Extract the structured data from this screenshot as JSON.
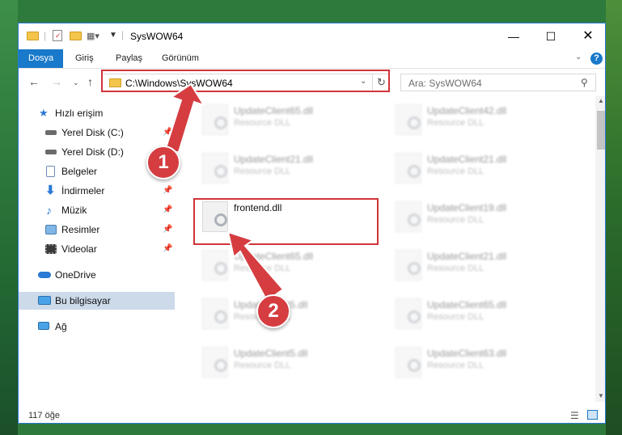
{
  "window": {
    "title": "SysWOW64"
  },
  "ribbon": {
    "tabs": [
      "Dosya",
      "Giriş",
      "Paylaş",
      "Görünüm"
    ]
  },
  "address": {
    "path": "C:\\Windows\\SysWOW64"
  },
  "search": {
    "placeholder": "Ara: SysWOW64"
  },
  "sidebar": {
    "items": [
      {
        "label": "Hızlı erişim",
        "icon": "star-icon",
        "pinned": false
      },
      {
        "label": "Yerel Disk (C:)",
        "icon": "drive-icon",
        "pinned": true
      },
      {
        "label": "Yerel Disk (D:)",
        "icon": "drive-icon",
        "pinned": true
      },
      {
        "label": "Belgeler",
        "icon": "documents-icon",
        "pinned": true
      },
      {
        "label": "İndirmeler",
        "icon": "download-icon",
        "pinned": true
      },
      {
        "label": "Müzik",
        "icon": "music-icon",
        "pinned": true
      },
      {
        "label": "Resimler",
        "icon": "pictures-icon",
        "pinned": true
      },
      {
        "label": "Videolar",
        "icon": "videos-icon",
        "pinned": true
      },
      {
        "label": "OneDrive",
        "icon": "cloud-icon",
        "pinned": false
      },
      {
        "label": "Bu bilgisayar",
        "icon": "computer-icon",
        "pinned": false
      },
      {
        "label": "Ağ",
        "icon": "network-icon",
        "pinned": false
      }
    ]
  },
  "files": [
    {
      "name": "UpdateClient65.dll",
      "desc": "Resource DLL"
    },
    {
      "name": "UpdateClient42.dll",
      "desc": "Resource DLL"
    },
    {
      "name": "UpdateClient21.dll",
      "desc": "Resource DLL"
    },
    {
      "name": "UpdateClient21.dll",
      "desc": "Resource DLL"
    },
    {
      "name": "frontend.dll",
      "desc": ""
    },
    {
      "name": "UpdateClient19.dll",
      "desc": "Resource DLL"
    },
    {
      "name": "UpdateClient65.dll",
      "desc": "Resource DLL"
    },
    {
      "name": "UpdateClient21.dll",
      "desc": "Resource DLL"
    },
    {
      "name": "UpdateClient5.dll",
      "desc": "Resource DLL"
    },
    {
      "name": "UpdateClient65.dll",
      "desc": "Resource DLL"
    },
    {
      "name": "UpdateClient5.dll",
      "desc": "Resource DLL"
    },
    {
      "name": "UpdateClient63.dll",
      "desc": "Resource DLL"
    }
  ],
  "status": {
    "count": "117 öğe"
  },
  "callouts": {
    "one": "1",
    "two": "2"
  },
  "colors": {
    "accent": "#1979ca",
    "highlight": "#d0343a",
    "selected": "#ccdaea"
  }
}
